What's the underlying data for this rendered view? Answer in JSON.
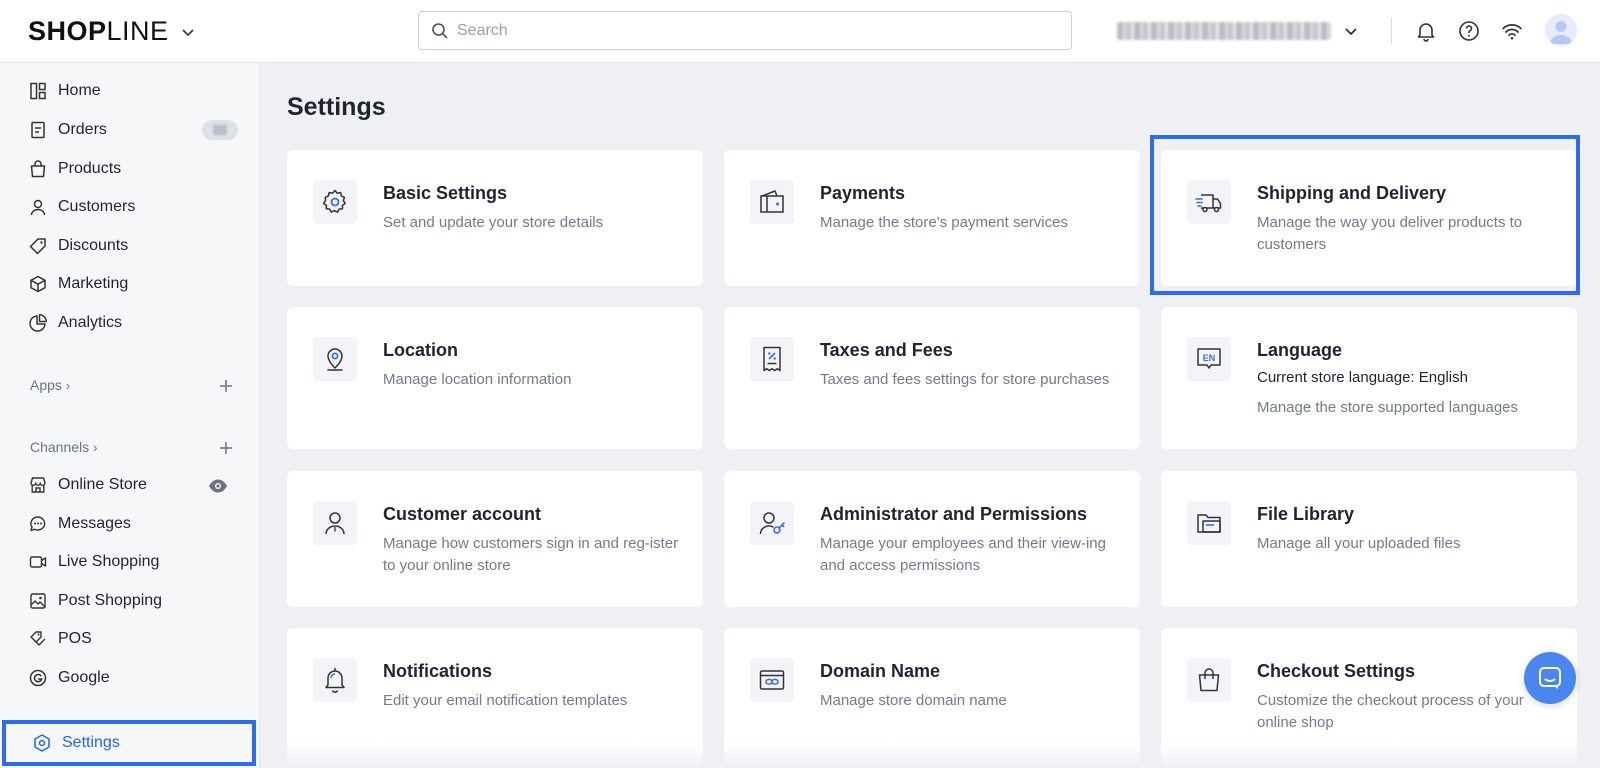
{
  "header": {
    "logo_bold": "SHOP",
    "logo_thin": "LINE",
    "search_placeholder": "Search",
    "store_name_redacted": true
  },
  "sidebar": {
    "items": [
      {
        "label": "Home",
        "icon": "home-icon"
      },
      {
        "label": "Orders",
        "icon": "orders-icon"
      },
      {
        "label": "Products",
        "icon": "products-icon"
      },
      {
        "label": "Customers",
        "icon": "customers-icon"
      },
      {
        "label": "Discounts",
        "icon": "discounts-icon"
      },
      {
        "label": "Marketing",
        "icon": "marketing-icon"
      },
      {
        "label": "Analytics",
        "icon": "analytics-icon"
      }
    ],
    "apps_label": "Apps",
    "channels_label": "Channels",
    "channels": [
      {
        "label": "Online Store",
        "icon": "online-store-icon"
      },
      {
        "label": "Messages",
        "icon": "messages-icon"
      },
      {
        "label": "Live Shopping",
        "icon": "live-shopping-icon"
      },
      {
        "label": "Post Shopping",
        "icon": "post-shopping-icon"
      },
      {
        "label": "POS",
        "icon": "pos-icon"
      },
      {
        "label": "Google",
        "icon": "google-icon"
      }
    ],
    "settings_label": "Settings"
  },
  "main": {
    "title": "Settings",
    "cards": [
      {
        "title": "Basic Settings",
        "desc": "Set and update your store details",
        "icon": "gear-icon"
      },
      {
        "title": "Payments",
        "desc": "Manage the store's payment services",
        "icon": "wallet-icon"
      },
      {
        "title": "Shipping and Delivery",
        "desc": "Manage the way you deliver products to customers",
        "icon": "truck-icon"
      },
      {
        "title": "Location",
        "desc": "Manage location information",
        "icon": "location-pin-icon"
      },
      {
        "title": "Taxes and Fees",
        "desc": "Taxes and fees settings for store purchases",
        "icon": "receipt-icon"
      },
      {
        "title": "Language",
        "sub": "Current store language: English",
        "desc": "Manage the store supported languages",
        "icon": "language-en-icon"
      },
      {
        "title": "Customer account",
        "desc": "Manage how customers sign in and reg-ister to your online store",
        "icon": "customer-account-icon"
      },
      {
        "title": "Administrator and Permissions",
        "desc": "Manage your employees and their view-ing and access permissions",
        "icon": "admin-key-icon"
      },
      {
        "title": "File Library",
        "desc": "Manage all your uploaded files",
        "icon": "folder-icon"
      },
      {
        "title": "Notifications",
        "desc": "Edit your email notification templates",
        "icon": "bell-icon"
      },
      {
        "title": "Domain Name",
        "desc": "Manage store domain name",
        "icon": "domain-link-icon"
      },
      {
        "title": "Checkout Settings",
        "desc": "Customize the checkout process of your online shop",
        "icon": "shopping-bag-icon"
      }
    ]
  },
  "colors": {
    "accent": "#2f6bf2",
    "icon_blue": "#3b6fe0",
    "text_primary": "#1f2430",
    "text_secondary": "#737b87",
    "background": "#eef0f4"
  }
}
